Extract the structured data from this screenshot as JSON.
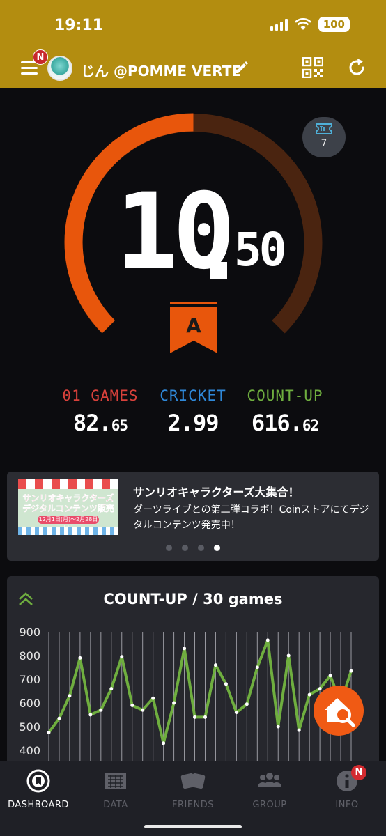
{
  "status_bar": {
    "time": "19:11",
    "battery": "100"
  },
  "header": {
    "menu_badge": "N",
    "username": "じん @POMME VERTE"
  },
  "rating": {
    "integer": "10",
    "decimal": "50",
    "class": "A",
    "progress": 0.5,
    "ticket_count": "7"
  },
  "stats": [
    {
      "label": "01 GAMES",
      "whole": "82.",
      "frac": "65",
      "color": "#d8413b"
    },
    {
      "label": "CRICKET",
      "whole": "2.99",
      "frac": "",
      "color": "#2f88d8"
    },
    {
      "label": "COUNT-UP",
      "whole": "616.",
      "frac": "62",
      "color": "#6fae3f"
    }
  ],
  "banner": {
    "image_text": "サンリオキャラクターズ デジタルコンテンツ販売",
    "image_date": "12月1日(月)～2月28日(土)",
    "title": "サンリオキャラクターズ大集合！",
    "body": "ダーツライブとの第二弾コラボ！Coinストアにてデジタルコンテンツ発売中！",
    "page_count": 4,
    "active_page": 3
  },
  "chart": {
    "title": "COUNT-UP / 30 games"
  },
  "chart_data": {
    "type": "line",
    "title": "COUNT-UP / 30 games",
    "xlabel": "",
    "ylabel": "",
    "ylim": [
      400,
      900
    ],
    "yticks": [
      900,
      800,
      700,
      600,
      500,
      400
    ],
    "grid": true,
    "x": [
      1,
      2,
      3,
      4,
      5,
      6,
      7,
      8,
      9,
      10,
      11,
      12,
      13,
      14,
      15,
      16,
      17,
      18,
      19,
      20,
      21,
      22,
      23,
      24,
      25,
      26,
      27,
      28,
      29,
      30
    ],
    "values": [
      475,
      535,
      630,
      790,
      550,
      570,
      660,
      795,
      590,
      570,
      620,
      430,
      600,
      830,
      540,
      540,
      760,
      680,
      560,
      595,
      750,
      865,
      500,
      800,
      485,
      635,
      660,
      715,
      600,
      735
    ],
    "color": "#6fae3f"
  },
  "tabs": [
    {
      "label": "DASHBOARD",
      "icon": "dashboard-icon",
      "active": true
    },
    {
      "label": "DATA",
      "icon": "data-icon",
      "active": false
    },
    {
      "label": "FRIENDS",
      "icon": "friends-icon",
      "active": false
    },
    {
      "label": "GROUP",
      "icon": "group-icon",
      "active": false
    },
    {
      "label": "INFO",
      "icon": "info-icon",
      "active": false,
      "badge": "N"
    }
  ],
  "colors": {
    "header": "#b38d10",
    "gauge_filled": "#e8560c",
    "gauge_empty": "#4a2410",
    "accent": "#f05a14",
    "chart_line": "#6fae3f"
  }
}
